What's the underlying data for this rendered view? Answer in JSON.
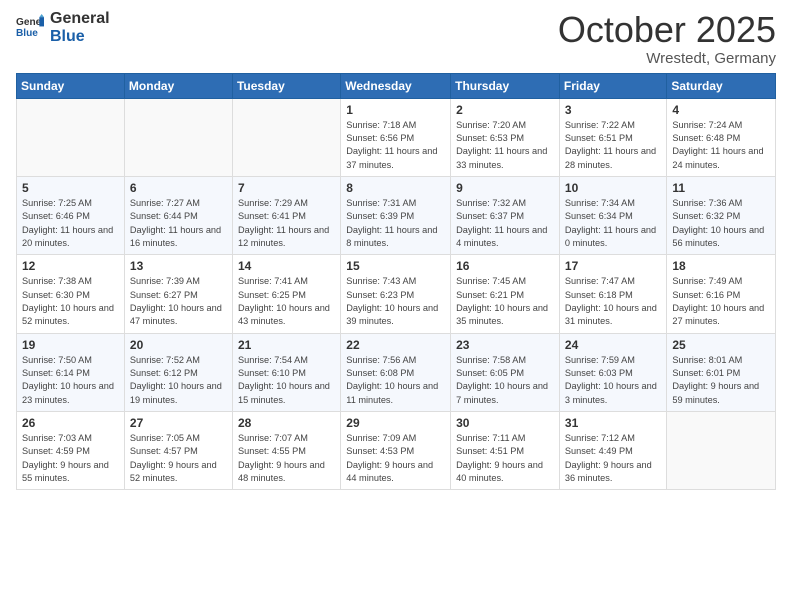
{
  "header": {
    "logo_general": "General",
    "logo_blue": "Blue",
    "month": "October 2025",
    "location": "Wrestedt, Germany"
  },
  "days_of_week": [
    "Sunday",
    "Monday",
    "Tuesday",
    "Wednesday",
    "Thursday",
    "Friday",
    "Saturday"
  ],
  "weeks": [
    [
      {
        "num": "",
        "info": ""
      },
      {
        "num": "",
        "info": ""
      },
      {
        "num": "",
        "info": ""
      },
      {
        "num": "1",
        "info": "Sunrise: 7:18 AM\nSunset: 6:56 PM\nDaylight: 11 hours and 37 minutes."
      },
      {
        "num": "2",
        "info": "Sunrise: 7:20 AM\nSunset: 6:53 PM\nDaylight: 11 hours and 33 minutes."
      },
      {
        "num": "3",
        "info": "Sunrise: 7:22 AM\nSunset: 6:51 PM\nDaylight: 11 hours and 28 minutes."
      },
      {
        "num": "4",
        "info": "Sunrise: 7:24 AM\nSunset: 6:48 PM\nDaylight: 11 hours and 24 minutes."
      }
    ],
    [
      {
        "num": "5",
        "info": "Sunrise: 7:25 AM\nSunset: 6:46 PM\nDaylight: 11 hours and 20 minutes."
      },
      {
        "num": "6",
        "info": "Sunrise: 7:27 AM\nSunset: 6:44 PM\nDaylight: 11 hours and 16 minutes."
      },
      {
        "num": "7",
        "info": "Sunrise: 7:29 AM\nSunset: 6:41 PM\nDaylight: 11 hours and 12 minutes."
      },
      {
        "num": "8",
        "info": "Sunrise: 7:31 AM\nSunset: 6:39 PM\nDaylight: 11 hours and 8 minutes."
      },
      {
        "num": "9",
        "info": "Sunrise: 7:32 AM\nSunset: 6:37 PM\nDaylight: 11 hours and 4 minutes."
      },
      {
        "num": "10",
        "info": "Sunrise: 7:34 AM\nSunset: 6:34 PM\nDaylight: 11 hours and 0 minutes."
      },
      {
        "num": "11",
        "info": "Sunrise: 7:36 AM\nSunset: 6:32 PM\nDaylight: 10 hours and 56 minutes."
      }
    ],
    [
      {
        "num": "12",
        "info": "Sunrise: 7:38 AM\nSunset: 6:30 PM\nDaylight: 10 hours and 52 minutes."
      },
      {
        "num": "13",
        "info": "Sunrise: 7:39 AM\nSunset: 6:27 PM\nDaylight: 10 hours and 47 minutes."
      },
      {
        "num": "14",
        "info": "Sunrise: 7:41 AM\nSunset: 6:25 PM\nDaylight: 10 hours and 43 minutes."
      },
      {
        "num": "15",
        "info": "Sunrise: 7:43 AM\nSunset: 6:23 PM\nDaylight: 10 hours and 39 minutes."
      },
      {
        "num": "16",
        "info": "Sunrise: 7:45 AM\nSunset: 6:21 PM\nDaylight: 10 hours and 35 minutes."
      },
      {
        "num": "17",
        "info": "Sunrise: 7:47 AM\nSunset: 6:18 PM\nDaylight: 10 hours and 31 minutes."
      },
      {
        "num": "18",
        "info": "Sunrise: 7:49 AM\nSunset: 6:16 PM\nDaylight: 10 hours and 27 minutes."
      }
    ],
    [
      {
        "num": "19",
        "info": "Sunrise: 7:50 AM\nSunset: 6:14 PM\nDaylight: 10 hours and 23 minutes."
      },
      {
        "num": "20",
        "info": "Sunrise: 7:52 AM\nSunset: 6:12 PM\nDaylight: 10 hours and 19 minutes."
      },
      {
        "num": "21",
        "info": "Sunrise: 7:54 AM\nSunset: 6:10 PM\nDaylight: 10 hours and 15 minutes."
      },
      {
        "num": "22",
        "info": "Sunrise: 7:56 AM\nSunset: 6:08 PM\nDaylight: 10 hours and 11 minutes."
      },
      {
        "num": "23",
        "info": "Sunrise: 7:58 AM\nSunset: 6:05 PM\nDaylight: 10 hours and 7 minutes."
      },
      {
        "num": "24",
        "info": "Sunrise: 7:59 AM\nSunset: 6:03 PM\nDaylight: 10 hours and 3 minutes."
      },
      {
        "num": "25",
        "info": "Sunrise: 8:01 AM\nSunset: 6:01 PM\nDaylight: 9 hours and 59 minutes."
      }
    ],
    [
      {
        "num": "26",
        "info": "Sunrise: 7:03 AM\nSunset: 4:59 PM\nDaylight: 9 hours and 55 minutes."
      },
      {
        "num": "27",
        "info": "Sunrise: 7:05 AM\nSunset: 4:57 PM\nDaylight: 9 hours and 52 minutes."
      },
      {
        "num": "28",
        "info": "Sunrise: 7:07 AM\nSunset: 4:55 PM\nDaylight: 9 hours and 48 minutes."
      },
      {
        "num": "29",
        "info": "Sunrise: 7:09 AM\nSunset: 4:53 PM\nDaylight: 9 hours and 44 minutes."
      },
      {
        "num": "30",
        "info": "Sunrise: 7:11 AM\nSunset: 4:51 PM\nDaylight: 9 hours and 40 minutes."
      },
      {
        "num": "31",
        "info": "Sunrise: 7:12 AM\nSunset: 4:49 PM\nDaylight: 9 hours and 36 minutes."
      },
      {
        "num": "",
        "info": ""
      }
    ]
  ]
}
